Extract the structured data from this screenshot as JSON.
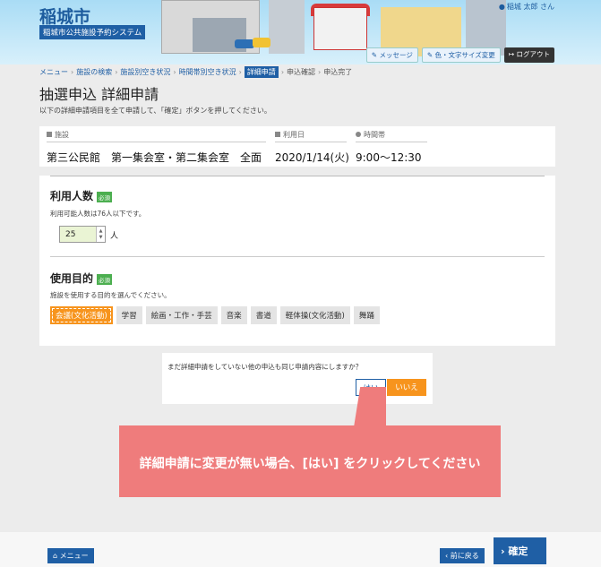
{
  "header": {
    "city": "稲城市",
    "system": "稲城市公共施設予約システム",
    "user": "稲城 太郎 さん",
    "message_btn": "メッセージ",
    "text_size_btn": "色・文字サイズ変更",
    "logout_btn": "ログアウト"
  },
  "breadcrumb": {
    "items": [
      "メニュー",
      "施設の検索",
      "施設別空き状況",
      "時間帯別空き状況",
      "詳細申請",
      "申込確認",
      "申込完了"
    ]
  },
  "page": {
    "title": "抽選申込 詳細申請",
    "description": "以下の詳細申請項目を全て申請して、「確定」ボタンを押してください。"
  },
  "facility": {
    "facility_label": "施設",
    "facility_value": "第三公民館　第一集会室・第二集会室　全面",
    "date_label": "利用日",
    "date_value": "2020/1/14(火)",
    "time_label": "時間帯",
    "time_value": "9:00～12:30"
  },
  "form": {
    "people_label": "利用人数",
    "required": "必須",
    "people_hint": "利用可能人数は76人以下です。",
    "people_value": "25",
    "people_unit": "人",
    "purpose_label": "使用目的",
    "purpose_hint": "施設を使用する目的を選んでください。",
    "purposes": [
      "会議(文化活動)",
      "学習",
      "絵画・工作・手芸",
      "音楽",
      "書道",
      "軽体操(文化活動)",
      "舞踊"
    ]
  },
  "dialog": {
    "question": "まだ詳細申請をしていない他の申込も同じ申請内容にしますか？",
    "yes": "はい",
    "no": "いいえ"
  },
  "callout": {
    "message": "詳細申請に変更が無い場合、[はい] をクリックしてください"
  },
  "footer": {
    "menu": "メニュー",
    "back": "前に戻る",
    "confirm": "確定"
  },
  "colors": {
    "primary": "#1f5fa5",
    "accent": "#f7941d",
    "callout": "#ef7c7c",
    "required": "#4caf50"
  }
}
